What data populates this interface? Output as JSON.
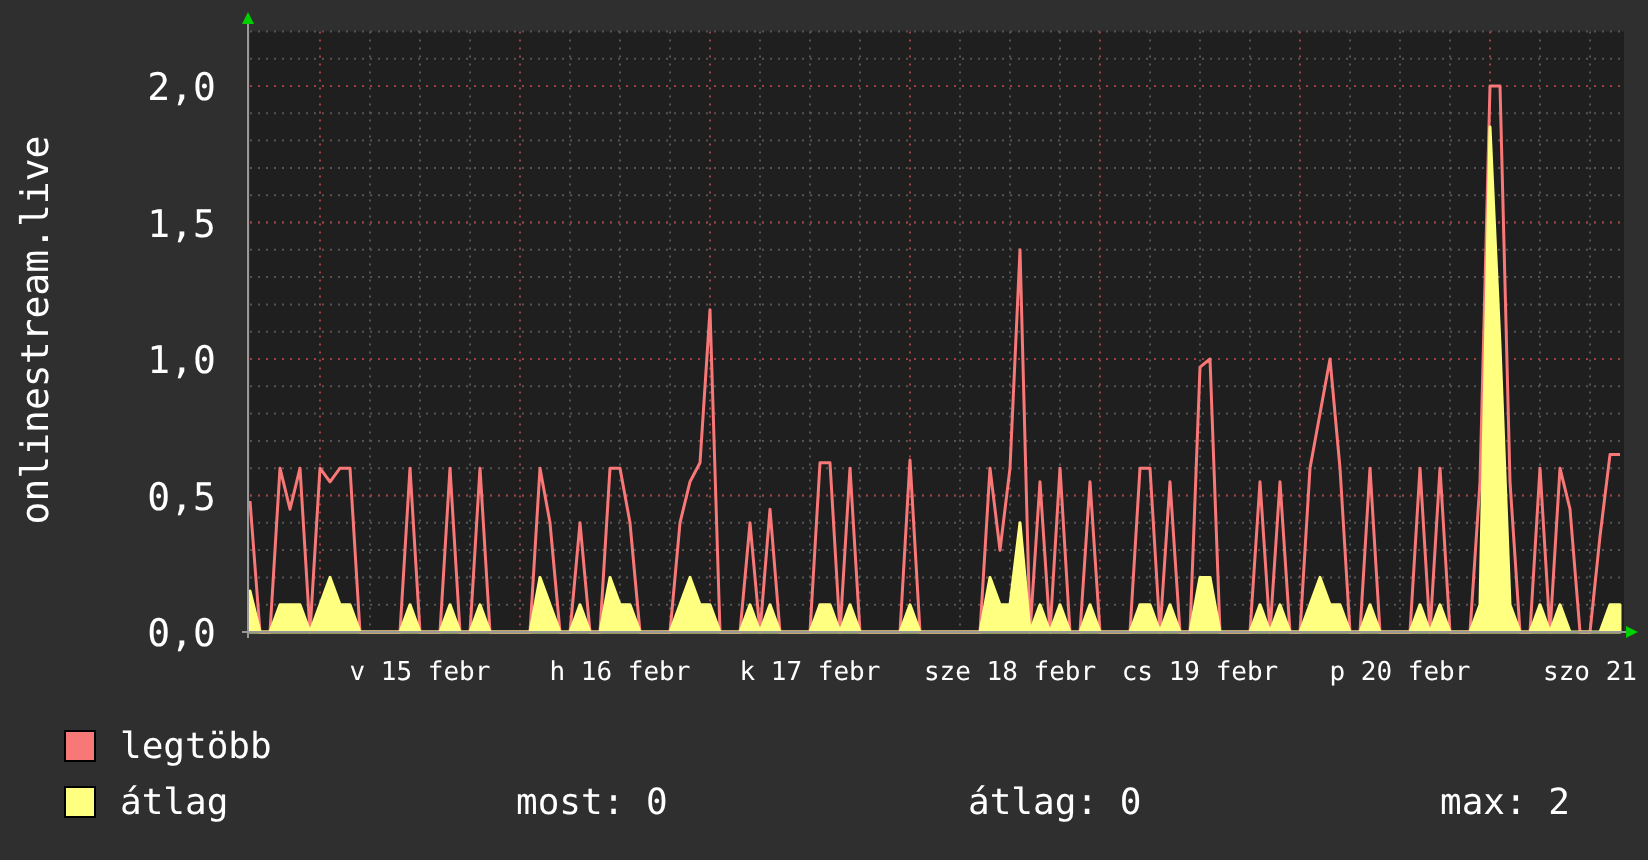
{
  "chart": {
    "chart_data": {
      "type": "area",
      "ylabel": "onlinestream.live",
      "grid": true,
      "ylim": [
        0,
        2.2
      ],
      "categories": [
        null,
        null,
        null,
        null,
        null,
        null,
        null,
        null,
        null,
        null,
        null,
        null,
        null,
        null,
        null,
        null,
        null,
        "v 15 febr",
        null,
        null,
        null,
        null,
        null,
        null,
        null,
        null,
        null,
        null,
        null,
        null,
        null,
        null,
        null,
        null,
        null,
        null,
        null,
        "h 16 febr",
        null,
        null,
        null,
        null,
        null,
        null,
        null,
        null,
        null,
        null,
        null,
        null,
        null,
        null,
        null,
        null,
        null,
        null,
        "k 17 febr",
        null,
        null,
        null,
        null,
        null,
        null,
        null,
        null,
        null,
        null,
        null,
        null,
        null,
        null,
        null,
        null,
        null,
        null,
        null,
        "sze 18 febr",
        null,
        null,
        null,
        null,
        null,
        null,
        null,
        null,
        null,
        null,
        null,
        null,
        null,
        null,
        null,
        null,
        null,
        null,
        "cs 19 febr",
        null,
        null,
        null,
        null,
        null,
        null,
        null,
        null,
        null,
        null,
        null,
        null,
        null,
        null,
        null,
        null,
        null,
        null,
        null,
        "p 20 febr",
        null,
        null,
        null,
        null,
        null,
        null,
        null,
        null,
        null,
        null,
        null,
        null,
        null,
        null,
        null,
        null,
        null,
        null,
        "szo 21",
        null,
        null,
        null
      ],
      "yticks": [
        {
          "value": 0,
          "label": "0,0"
        },
        {
          "value": 0.5,
          "label": "0,5"
        },
        {
          "value": 1,
          "label": "1,0"
        },
        {
          "value": 1.5,
          "label": "1,5"
        },
        {
          "value": 2,
          "label": "2,0"
        }
      ],
      "series": [
        {
          "name": "legtöbb",
          "color": "#f87878",
          "type": "line",
          "values": [
            0.48,
            0,
            0,
            0.6,
            0.45,
            0.6,
            0,
            0.6,
            0.55,
            0.6,
            0.6,
            0,
            0,
            0,
            0,
            0,
            0.6,
            0,
            0,
            0,
            0.6,
            0,
            0,
            0.6,
            0,
            0,
            0,
            0,
            0,
            0.6,
            0.4,
            0,
            0,
            0.4,
            0,
            0,
            0.6,
            0.6,
            0.4,
            0,
            0,
            0,
            0,
            0.4,
            0.55,
            0.62,
            1.18,
            0,
            0,
            0,
            0.4,
            0,
            0.45,
            0,
            0,
            0,
            0,
            0.62,
            0.62,
            0,
            0.6,
            0,
            0,
            0,
            0,
            0,
            0.63,
            0,
            0,
            0,
            0,
            0,
            0,
            0,
            0.6,
            0.3,
            0.6,
            1.4,
            0,
            0.55,
            0,
            0.6,
            0,
            0,
            0.55,
            0,
            0,
            0,
            0,
            0.6,
            0.6,
            0,
            0.55,
            0,
            0,
            0.97,
            1.0,
            0,
            0,
            0,
            0,
            0.55,
            0,
            0.55,
            0,
            0,
            0.6,
            0.8,
            1.0,
            0.6,
            0,
            0,
            0.6,
            0,
            0,
            0,
            0,
            0.6,
            0,
            0.6,
            0,
            0,
            0,
            0.55,
            2.0,
            2.0,
            0.55,
            0,
            0,
            0.6,
            0,
            0.6,
            0.45,
            0,
            0,
            0.35,
            0.65,
            0.65
          ]
        },
        {
          "name": "átlag",
          "color": "#ffff80",
          "type": "area",
          "values": [
            0.15,
            0,
            0,
            0.1,
            0.1,
            0.1,
            0,
            0.1,
            0.2,
            0.1,
            0.1,
            0,
            0,
            0,
            0,
            0,
            0.1,
            0,
            0,
            0,
            0.1,
            0,
            0,
            0.1,
            0,
            0,
            0,
            0,
            0,
            0.2,
            0.1,
            0,
            0,
            0.1,
            0,
            0,
            0.2,
            0.1,
            0.1,
            0,
            0,
            0,
            0,
            0.1,
            0.2,
            0.1,
            0.1,
            0,
            0,
            0,
            0.1,
            0,
            0.1,
            0,
            0,
            0,
            0,
            0.1,
            0.1,
            0,
            0.1,
            0,
            0,
            0,
            0,
            0,
            0.1,
            0,
            0,
            0,
            0,
            0,
            0,
            0,
            0.2,
            0.1,
            0.1,
            0.4,
            0,
            0.1,
            0,
            0.1,
            0,
            0,
            0.1,
            0,
            0,
            0,
            0,
            0.1,
            0.1,
            0,
            0.1,
            0,
            0,
            0.2,
            0.2,
            0,
            0,
            0,
            0,
            0.1,
            0,
            0.1,
            0,
            0,
            0.1,
            0.2,
            0.1,
            0.1,
            0,
            0,
            0.1,
            0,
            0,
            0,
            0,
            0.1,
            0,
            0.1,
            0,
            0,
            0,
            0.1,
            1.85,
            1.05,
            0.1,
            0,
            0,
            0.1,
            0,
            0.1,
            0,
            0,
            0,
            0,
            0.1,
            0.1
          ]
        }
      ]
    }
  },
  "legend": {
    "stats": [
      "most: 0",
      "átlag: 0",
      "max: 2"
    ]
  }
}
